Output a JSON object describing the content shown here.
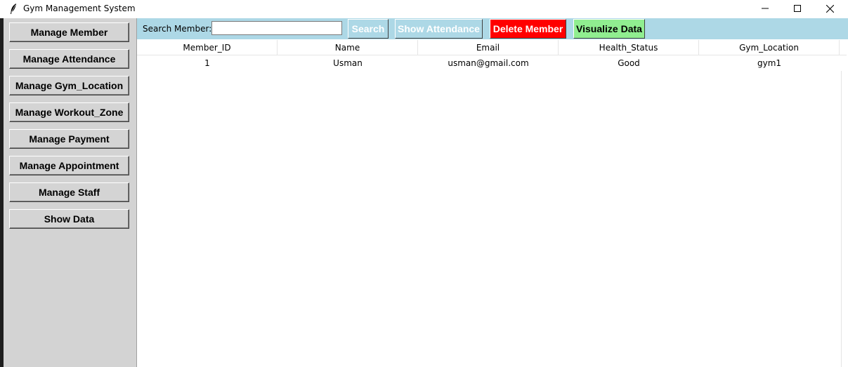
{
  "window": {
    "title": "Gym Management System",
    "controls": {
      "minimize": "—",
      "maximize": "☐",
      "close": "✕"
    }
  },
  "sidebar": {
    "items": [
      {
        "label": "Manage Member"
      },
      {
        "label": "Manage Attendance"
      },
      {
        "label": "Manage Gym_Location"
      },
      {
        "label": "Manage Workout_Zone"
      },
      {
        "label": "Manage Payment"
      },
      {
        "label": "Manage Appointment"
      },
      {
        "label": "Manage Staff"
      },
      {
        "label": "Show Data"
      }
    ]
  },
  "toolbar": {
    "search_label": "Search Member:",
    "search_value": "",
    "search_button": "Search",
    "show_attendance_button": "Show Attendance",
    "delete_button": "Delete Member",
    "visualize_button": "Visualize Data"
  },
  "table": {
    "columns": [
      "Member_ID",
      "Name",
      "Email",
      "Health_Status",
      "Gym_Location"
    ],
    "rows": [
      [
        "1",
        "Usman",
        "usman@gmail.com",
        "Good",
        "gym1"
      ]
    ]
  },
  "colors": {
    "toolbar_bg": "#add8e6",
    "sidebar_bg": "#d3d3d3",
    "delete_bg": "#ff0000",
    "visualize_bg": "#90ee90"
  }
}
